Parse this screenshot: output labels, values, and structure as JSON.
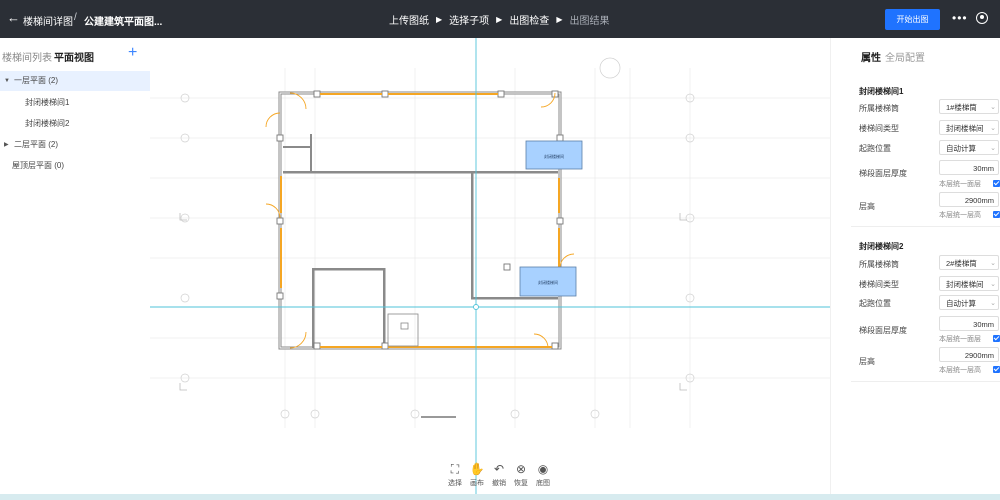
{
  "header": {
    "back_icon": "arrow-left-icon",
    "breadcrumb_1": "楼梯间详图",
    "breadcrumb_sep": "/",
    "breadcrumb_2": "公建建筑平面图...",
    "steps": [
      {
        "label": "上传图纸",
        "state": "done"
      },
      {
        "label": "选择子项",
        "state": "done"
      },
      {
        "label": "出图检查",
        "state": "current"
      },
      {
        "label": "出图结果",
        "state": "pending"
      }
    ],
    "start_button": "开始出图",
    "more_icon": "more-dots-icon",
    "user_icon": "user-icon"
  },
  "left_panel": {
    "tabs": [
      "楼梯间列表",
      "平面视图"
    ],
    "active_tab": "平面视图",
    "add_icon": "plus-icon",
    "tree": [
      {
        "label": "一层平面 (2)",
        "expanded": true,
        "selected": true
      },
      {
        "label": "封闭楼梯间1",
        "child": true
      },
      {
        "label": "封闭楼梯间2",
        "child": true
      },
      {
        "label": "二层平面 (2)",
        "expanded": false
      },
      {
        "label": "屋顶层平面 (0)"
      }
    ]
  },
  "canvas": {
    "room_labels": [
      "封闭楼梯间",
      "封闭楼梯间"
    ]
  },
  "right_panel": {
    "tabs": [
      "属性",
      "全局配置"
    ],
    "active_tab": "属性",
    "sections": [
      {
        "title": "封闭楼梯间1",
        "stair_label": "所属楼梯筒",
        "stair_value": "1#楼梯筒",
        "type_label": "楼梯间类型",
        "type_value": "封闭楼梯间",
        "start_label": "起跑位置",
        "start_value": "自动计算",
        "thickness_label": "梯段面层厚度",
        "thickness_value": "30mm",
        "thickness_check": "本层统一面层",
        "height_label": "层高",
        "height_value": "2900mm",
        "height_check": "本层统一层高"
      },
      {
        "title": "封闭楼梯间2",
        "stair_label": "所属楼梯筒",
        "stair_value": "2#楼梯筒",
        "type_label": "楼梯间类型",
        "type_value": "封闭楼梯间",
        "start_label": "起跑位置",
        "start_value": "自动计算",
        "thickness_label": "梯段面层厚度",
        "thickness_value": "30mm",
        "thickness_check": "本层统一面层",
        "height_label": "层高",
        "height_value": "2900mm",
        "height_check": "本层统一层高"
      }
    ]
  },
  "toolbar": [
    {
      "label": "选择",
      "icon": "select-frame-icon"
    },
    {
      "label": "画布",
      "icon": "hand-icon"
    },
    {
      "label": "撤销",
      "icon": "undo-icon"
    },
    {
      "label": "恢复",
      "icon": "redo-icon"
    },
    {
      "label": "底图",
      "icon": "eye-icon"
    }
  ],
  "colors": {
    "topbar": "#2b2f36",
    "accent": "#1f73ff",
    "selected_row": "#e8f1ff",
    "wall_highlight": "#f5a623",
    "room_fill": "#a8d1ff",
    "crosshair": "#4fc3d9"
  }
}
